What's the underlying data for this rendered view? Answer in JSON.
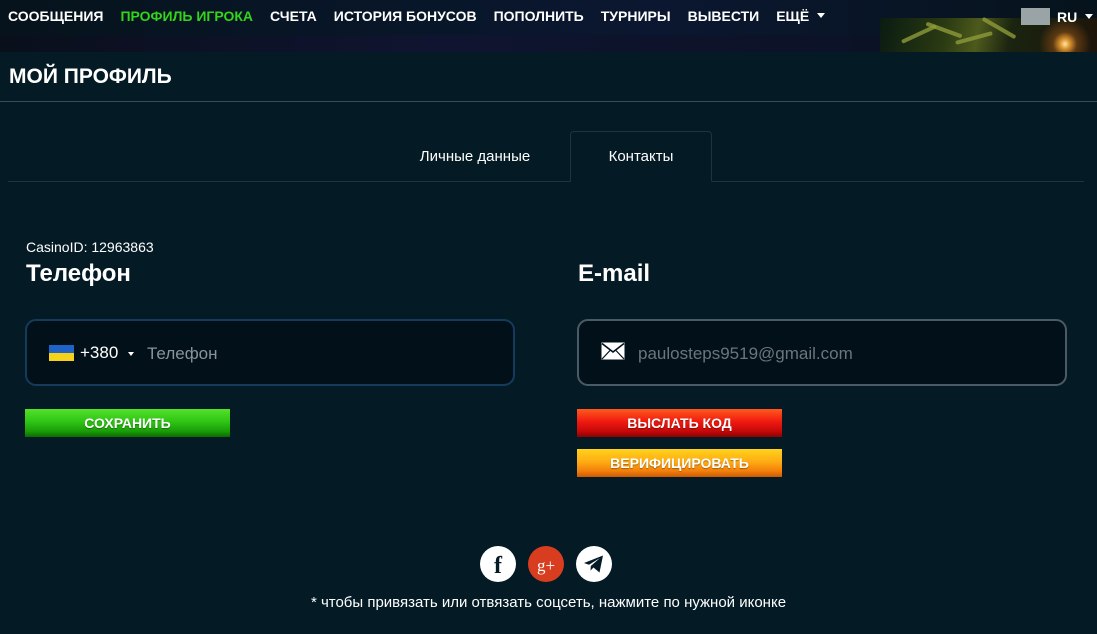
{
  "nav": {
    "items": [
      {
        "label": "СООБЩЕНИЯ",
        "active": false
      },
      {
        "label": "ПРОФИЛЬ ИГРОКА",
        "active": true
      },
      {
        "label": "СЧЕТА",
        "active": false
      },
      {
        "label": "ИСТОРИЯ БОНУСОВ",
        "active": false
      },
      {
        "label": "ПОПОЛНИТЬ",
        "active": false
      },
      {
        "label": "ТУРНИРЫ",
        "active": false
      },
      {
        "label": "ВЫВЕСТИ",
        "active": false
      }
    ],
    "more_label": "ЕЩЁ",
    "language": "RU",
    "active_color": "#33d41a"
  },
  "page": {
    "title": "МОЙ ПРОФИЛЬ"
  },
  "tabs": [
    {
      "label": "Личные данные",
      "selected": false
    },
    {
      "label": "Контакты",
      "selected": true
    }
  ],
  "phone": {
    "casino_id": "CasinoID: 12963863",
    "title": "Телефон",
    "country_flag": "ua-flag-icon",
    "dial_code": "+380",
    "value": "",
    "placeholder": "Телефон",
    "save_label": "СОХРАНИТЬ"
  },
  "email": {
    "title": "E-mail",
    "icon": "mail-icon",
    "value": "",
    "placeholder": "paulosteps9519@gmail.com",
    "send_code_label": "ВЫСЛАТЬ КОД",
    "verify_label": "ВЕРИФИЦИРОВАТЬ"
  },
  "social": {
    "icons": [
      "facebook-icon",
      "google-plus-icon",
      "telegram-icon"
    ],
    "fb_glyph": "f",
    "gp_glyph": "g+",
    "hint": "* чтобы привязать или отвязать соцсеть, нажмите по нужной иконке"
  },
  "colors": {
    "background": "#041a24",
    "save": "#2fc514",
    "send_code": "#f01a10",
    "verify": "#ffac14",
    "google_plus": "#d93d1f"
  }
}
